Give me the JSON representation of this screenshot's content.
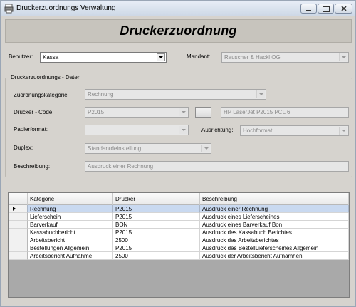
{
  "window": {
    "title": "Druckerzuordnungs Verwaltung"
  },
  "banner": {
    "title": "Druckerzuordnung"
  },
  "top": {
    "benutzer_label": "Benutzer:",
    "benutzer_value": "Kassa",
    "mandant_label": "Mandant:",
    "mandant_value": "Rauscher & Hackl OG"
  },
  "group": {
    "legend": "Druckerzuordnungs - Daten",
    "kategorie_label": "Zuordnungskategorie",
    "kategorie_value": "Rechnung",
    "drucker_label": "Drucker - Code:",
    "drucker_value": "P2015",
    "drucker_name": "HP LaserJet P2015 PCL 6",
    "papier_label": "Papierformat:",
    "papier_value": "",
    "ausrichtung_label": "Ausrichtung:",
    "ausrichtung_value": "Hochformat",
    "duplex_label": "Duplex:",
    "duplex_value": "Standanrdeinstellung",
    "beschreibung_label": "Beschreibung:",
    "beschreibung_value": "Ausdruck einer Rechnung"
  },
  "grid": {
    "columns": [
      "Kategorie",
      "Drucker",
      "Beschreibung"
    ],
    "rows": [
      [
        "Rechnung",
        "P2015",
        "Ausdruck einer Rechnung"
      ],
      [
        "Lieferschein",
        "P2015",
        "Ausdruck eines Lieferscheines"
      ],
      [
        "Barverkauf",
        "BON",
        "Ausdruck eines Barverkauf Bon"
      ],
      [
        "Kassabuchbericht",
        "P2015",
        "Ausdruck des Kassabuch Berichtes"
      ],
      [
        "Arbeitsbericht",
        "2500",
        "Ausdruck des Arbeitsberichtes"
      ],
      [
        "Bestellungen Allgemein",
        "P2015",
        "Ausdruck des BestellLieferscheines Allgemein"
      ],
      [
        "Arbeitsbericht Aufnahme",
        "2500",
        "Ausdruck der Arbeitsbericht Aufnamhen"
      ]
    ],
    "selected_row": 0
  },
  "colors": {
    "selection": "#c9d9f0",
    "window_bg": "#d6d3ce",
    "grid_empty": "#a9a9a9"
  }
}
